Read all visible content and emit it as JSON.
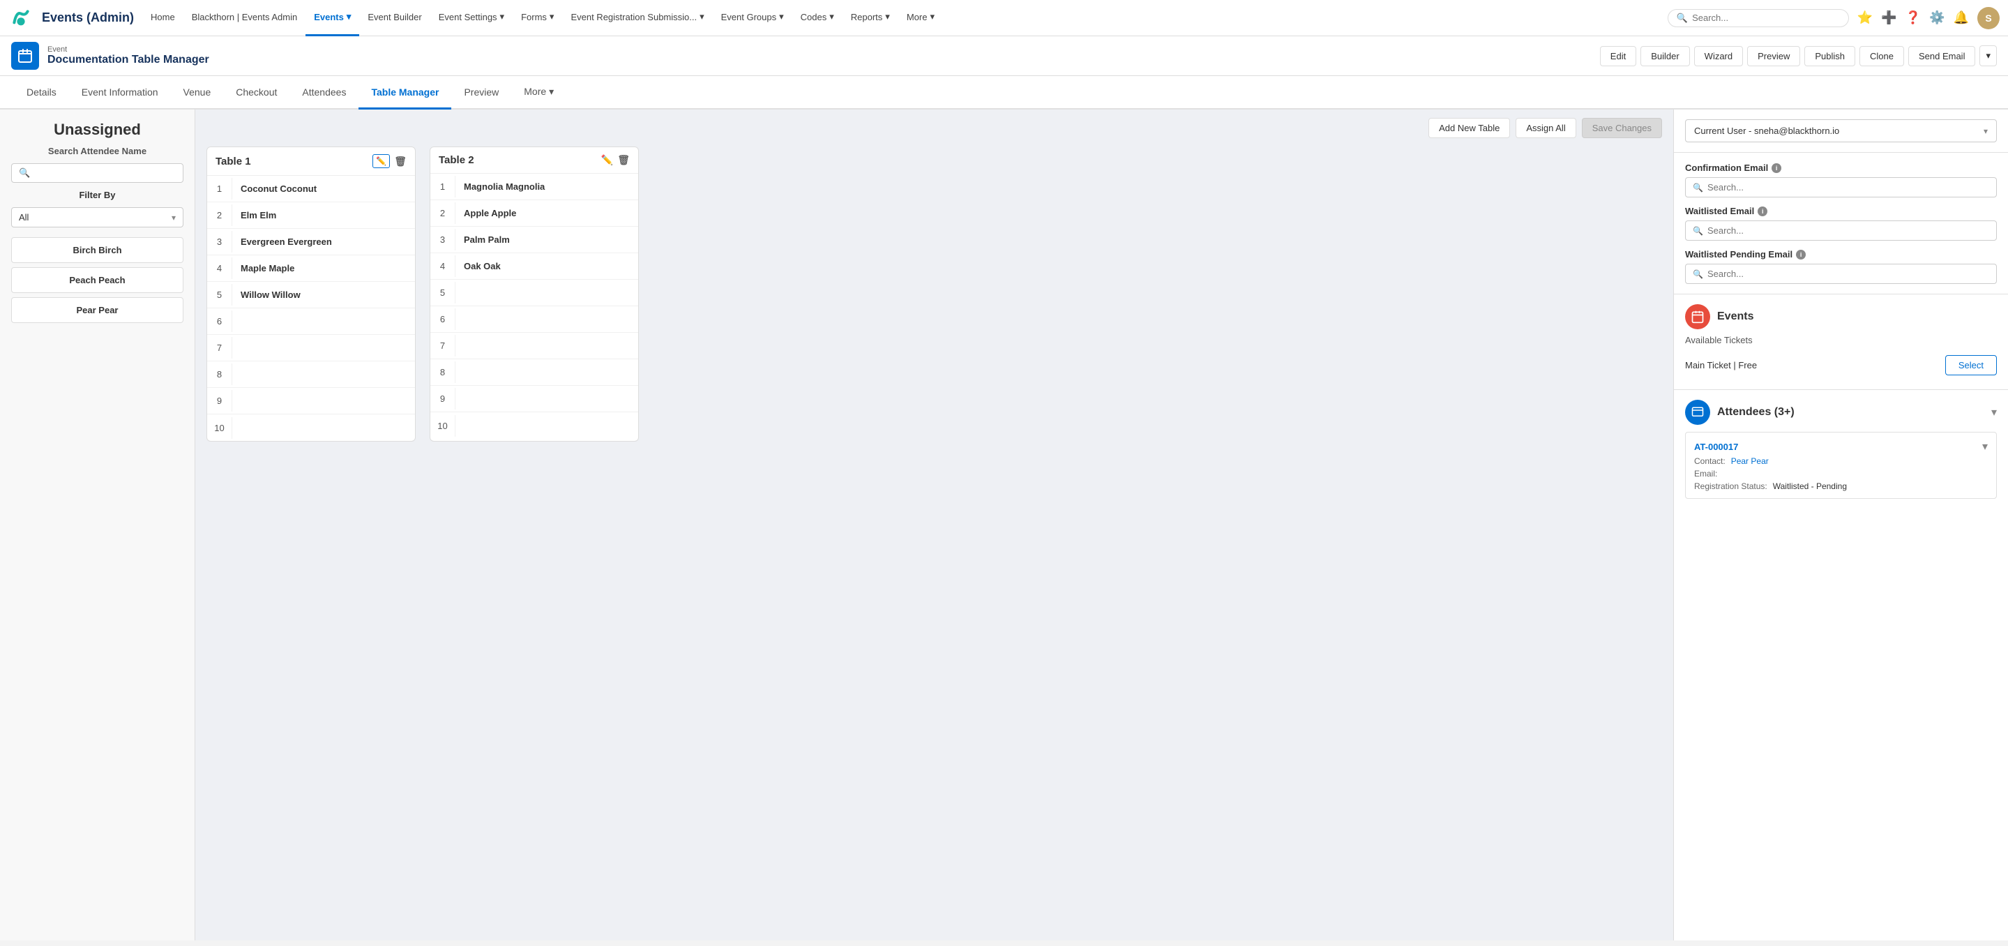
{
  "topbar": {
    "app_name": "Events (Admin)",
    "search_placeholder": "Search...",
    "nav_items": [
      {
        "label": "Home",
        "active": false
      },
      {
        "label": "Blackthorn | Events Admin",
        "active": false
      },
      {
        "label": "Events",
        "active": true,
        "has_arrow": true
      },
      {
        "label": "Event Builder",
        "active": false
      },
      {
        "label": "Event Settings",
        "active": false,
        "has_arrow": true
      },
      {
        "label": "Forms",
        "active": false,
        "has_arrow": true
      },
      {
        "label": "Event Registration Submissio...",
        "active": false,
        "has_arrow": true
      },
      {
        "label": "Event Groups",
        "active": false,
        "has_arrow": true
      },
      {
        "label": "Codes",
        "active": false,
        "has_arrow": true
      },
      {
        "label": "Reports",
        "active": false,
        "has_arrow": true
      },
      {
        "label": "More",
        "active": false,
        "has_arrow": true
      }
    ]
  },
  "event_header": {
    "label": "Event",
    "title": "Documentation Table Manager",
    "buttons": {
      "edit": "Edit",
      "builder": "Builder",
      "wizard": "Wizard",
      "preview": "Preview",
      "publish": "Publish",
      "clone": "Clone",
      "send_email": "Send Email"
    }
  },
  "tabs": [
    {
      "label": "Details",
      "active": false
    },
    {
      "label": "Event Information",
      "active": false
    },
    {
      "label": "Venue",
      "active": false
    },
    {
      "label": "Checkout",
      "active": false
    },
    {
      "label": "Attendees",
      "active": false
    },
    {
      "label": "Table Manager",
      "active": true
    },
    {
      "label": "Preview",
      "active": false
    },
    {
      "label": "More",
      "active": false,
      "has_arrow": true
    }
  ],
  "left_panel": {
    "title": "Unassigned",
    "search_label": "Search Attendee Name",
    "search_placeholder": "",
    "filter_label": "Filter By",
    "filter_value": "All",
    "attendees": [
      {
        "name": "Birch Birch"
      },
      {
        "name": "Peach Peach"
      },
      {
        "name": "Pear Pear"
      }
    ]
  },
  "center": {
    "toolbar": {
      "add_table": "Add New Table",
      "assign_all": "Assign All",
      "save_changes": "Save Changes"
    },
    "tables": [
      {
        "id": "table1",
        "name": "Table 1",
        "rows": [
          {
            "num": 1,
            "name": "Coconut Coconut"
          },
          {
            "num": 2,
            "name": "Elm Elm"
          },
          {
            "num": 3,
            "name": "Evergreen Evergreen"
          },
          {
            "num": 4,
            "name": "Maple Maple"
          },
          {
            "num": 5,
            "name": "Willow Willow"
          },
          {
            "num": 6,
            "name": ""
          },
          {
            "num": 7,
            "name": ""
          },
          {
            "num": 8,
            "name": ""
          },
          {
            "num": 9,
            "name": ""
          },
          {
            "num": 10,
            "name": ""
          }
        ]
      },
      {
        "id": "table2",
        "name": "Table 2",
        "rows": [
          {
            "num": 1,
            "name": "Magnolia Magnolia"
          },
          {
            "num": 2,
            "name": "Apple Apple"
          },
          {
            "num": 3,
            "name": "Palm Palm"
          },
          {
            "num": 4,
            "name": "Oak Oak"
          },
          {
            "num": 5,
            "name": ""
          },
          {
            "num": 6,
            "name": ""
          },
          {
            "num": 7,
            "name": ""
          },
          {
            "num": 8,
            "name": ""
          },
          {
            "num": 9,
            "name": ""
          },
          {
            "num": 10,
            "name": ""
          }
        ]
      }
    ]
  },
  "right_panel": {
    "user_select": "Current User - sneha@blackthorn.io",
    "confirmation_email_label": "Confirmation Email",
    "confirmation_email_placeholder": "Search...",
    "waitlisted_email_label": "Waitlisted Email",
    "waitlisted_email_placeholder": "Search...",
    "waitlisted_pending_label": "Waitlisted Pending Email",
    "waitlisted_pending_placeholder": "Search...",
    "events_section_title": "Events",
    "available_tickets_label": "Available Tickets",
    "ticket_name": "Main Ticket | Free",
    "select_btn": "Select",
    "attendees_title": "Attendees (3+)",
    "attendee_record": {
      "id": "AT-000017",
      "contact_label": "Contact:",
      "contact_value": "Pear Pear",
      "email_label": "Email:",
      "email_value": "",
      "status_label": "Registration Status:",
      "status_value": "Waitlisted - Pending"
    }
  }
}
